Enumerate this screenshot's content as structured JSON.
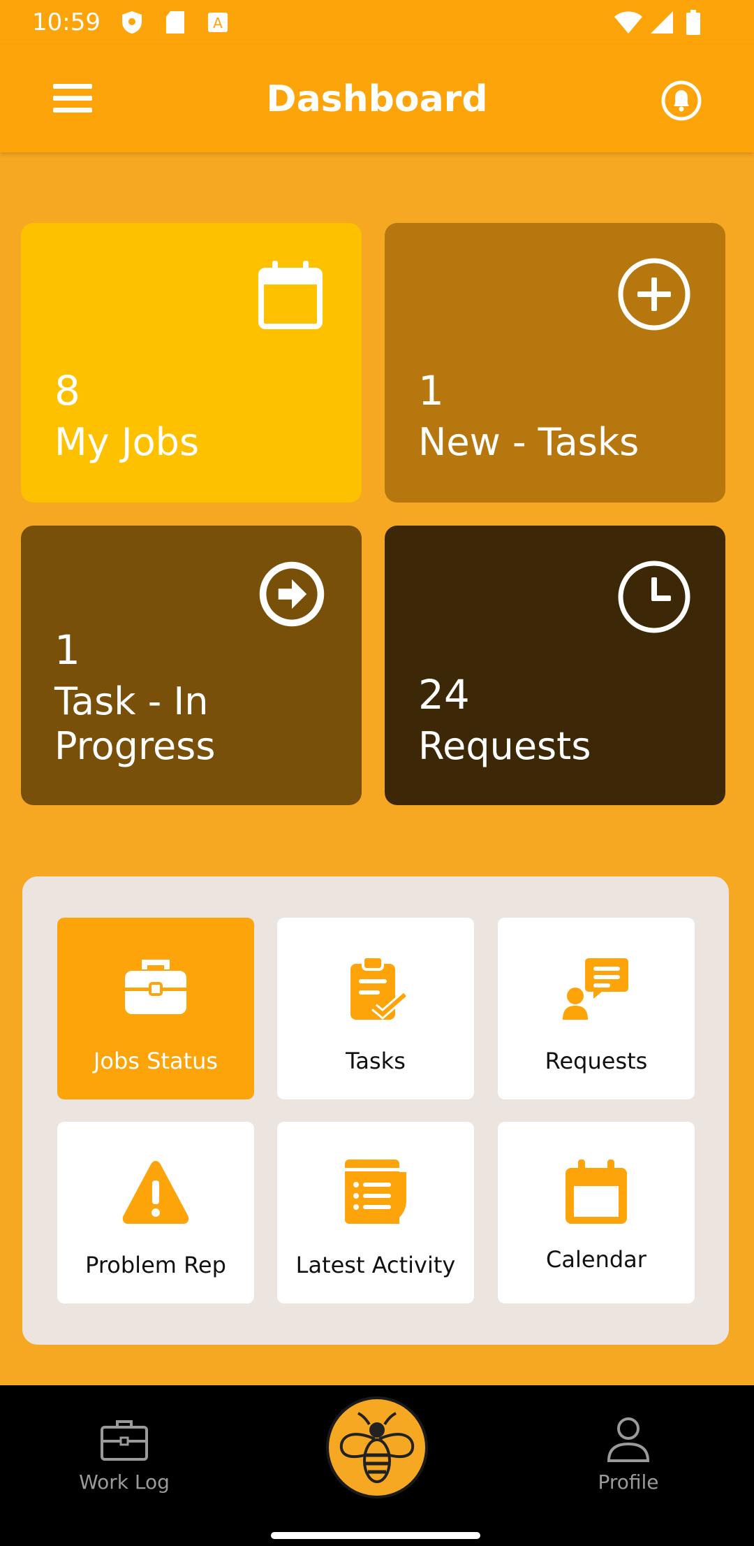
{
  "status_bar": {
    "time": "10:59"
  },
  "app_bar": {
    "title": "Dashboard"
  },
  "cards": [
    {
      "count": "8",
      "label": "My Jobs",
      "icon": "calendar-icon"
    },
    {
      "count": "1",
      "label": "New - Tasks",
      "icon": "plus-circle-icon"
    },
    {
      "count": "1",
      "label": "Task - In Progress",
      "icon": "arrow-right-circle-icon"
    },
    {
      "count": "24",
      "label": "Requests",
      "icon": "clock-icon"
    }
  ],
  "tiles": [
    {
      "label": "Jobs Status",
      "icon": "briefcase-icon",
      "active": true
    },
    {
      "label": "Tasks",
      "icon": "clipboard-check-icon"
    },
    {
      "label": "Requests",
      "icon": "user-chat-icon"
    },
    {
      "label": "Problem Rep",
      "icon": "warning-icon"
    },
    {
      "label": "Latest Activity",
      "icon": "document-list-icon"
    },
    {
      "label": "Calendar",
      "icon": "calendar-icon"
    }
  ],
  "bottom_nav": {
    "work_log": "Work Log",
    "profile": "Profile"
  },
  "colors": {
    "primary": "#FCA409",
    "background": "#F7A823",
    "card_my_jobs": "#FDC100",
    "card_new_tasks": "#B7770F",
    "card_in_progress": "#79500A",
    "card_requests": "#3C2806"
  }
}
